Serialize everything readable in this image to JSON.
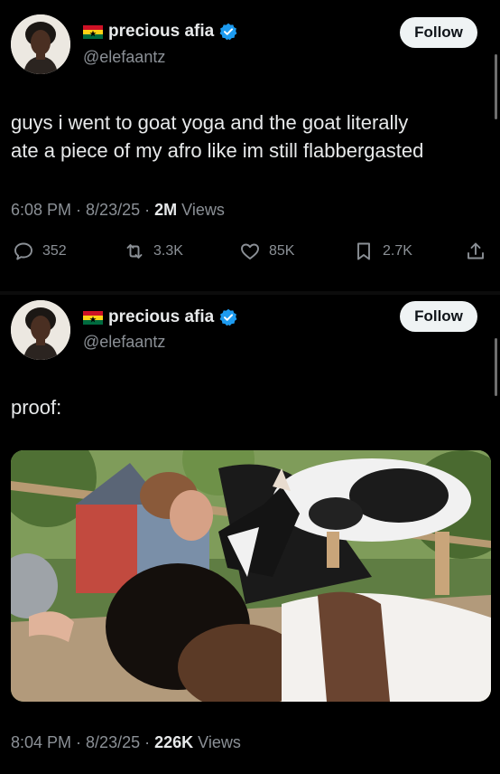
{
  "posts": [
    {
      "author": {
        "name": "precious afia",
        "handle": "@elefaantz",
        "flag_icon": "ghana-flag-icon",
        "verified": true
      },
      "follow_label": "Follow",
      "text_lines": [
        "guys i went to goat yoga and the goat literally",
        "ate a piece of my afro like im still flabbergasted"
      ],
      "time": "6:08 PM",
      "date": "8/23/25",
      "views_count": "2M",
      "views_label": "Views",
      "stats": {
        "replies": "352",
        "reposts": "3.3K",
        "likes": "85K",
        "bookmarks": "2.7K"
      }
    },
    {
      "author": {
        "name": "precious afia",
        "handle": "@elefaantz",
        "flag_icon": "ghana-flag-icon",
        "verified": true
      },
      "follow_label": "Follow",
      "text": "proof:",
      "time": "8:04 PM",
      "date": "8/23/25",
      "views_count": "226K",
      "views_label": "Views",
      "media_description_icon": "photo-goat-yoga"
    }
  ],
  "colors": {
    "background": "#000000",
    "text": "#e7e9ea",
    "muted": "#8b9096",
    "verified": "#1d9bf0",
    "follow_bg": "#eff3f4"
  },
  "icons": [
    "reply-icon",
    "repost-icon",
    "like-icon",
    "bookmark-icon",
    "share-icon",
    "verified-badge-icon"
  ]
}
